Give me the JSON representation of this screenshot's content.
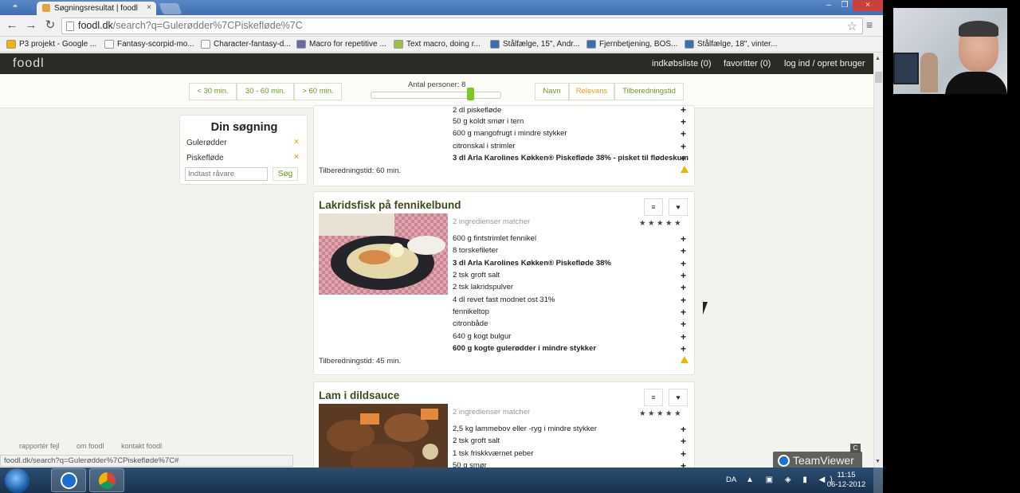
{
  "browser": {
    "tab_title": "Søgningsresultat | foodl",
    "tab_close": "×",
    "url_host": "foodl.dk",
    "url_path": "/search?q=Gulerødder%7CPiskefløde%7C",
    "nav_back": "←",
    "nav_forward": "→",
    "nav_reload": "↻",
    "star": "☆",
    "menu": "≡",
    "bookmarks": [
      {
        "label": "P3 projekt - Google ...",
        "color": "#f4b400"
      },
      {
        "label": "Fantasy-scorpid-mo...",
        "color": "#ffffff"
      },
      {
        "label": "Character-fantasy-d...",
        "color": "#ffffff"
      },
      {
        "label": "Macro for repetitive ...",
        "color": "#6a6aa0"
      },
      {
        "label": "Text macro, doing r...",
        "color": "#a0c040"
      },
      {
        "label": "Stålfælge, 15\", Andr...",
        "color": "#3a6fb0"
      },
      {
        "label": "Fjernbetjening, BOS...",
        "color": "#3a6fb0"
      },
      {
        "label": "Stålfælge, 18\", vinter...",
        "color": "#3a6fb0"
      }
    ],
    "status_url": "foodl.dk/search?q=Gulerødder%7CPiskefløde%7C#"
  },
  "site": {
    "logo": "foodl",
    "header_links": {
      "shopping_list": "indkøbsliste (0)",
      "favorites": "favoritter (0)",
      "login": "log ind / opret bruger"
    },
    "time_filters": [
      "< 30 min.",
      "30 - 60 min.",
      "> 60 min."
    ],
    "persons_label": "Antal personer: 8",
    "persons_value": 8,
    "sort_options": [
      "Navn",
      "Relevans",
      "Tilberedningstid"
    ],
    "active_sort": "Relevans",
    "search_panel": {
      "title": "Din søgning",
      "terms": [
        "Gulerødder",
        "Piskefløde"
      ],
      "remove_glyph": "×",
      "input_placeholder": "Indtast råvare",
      "button": "Søg"
    },
    "footer_links": [
      "rapportér fejl",
      "om foodl",
      "kontakt foodl"
    ]
  },
  "recipes": [
    {
      "title": "",
      "ingredients": [
        {
          "text": "2 dl piskefløde",
          "bold": false
        },
        {
          "text": "50 g koldt smør i tern",
          "bold": false
        },
        {
          "text": "600 g mangofrugt i mindre stykker",
          "bold": false
        },
        {
          "text": "citronskal i strimler",
          "bold": false
        },
        {
          "text": "3 dl Arla Karolines Køkken® Piskefløde 38% - pisket til flødeskum",
          "bold": true
        }
      ],
      "prep_time": "Tilberedningstid: 60 min."
    },
    {
      "title": "Lakridsfisk på fennikelbund",
      "match": "2 ingredienser matcher",
      "stars": "★★★★★",
      "ingredients": [
        {
          "text": "600 g fintstrimlet fennikel",
          "bold": false
        },
        {
          "text": "8 torskefileter",
          "bold": false
        },
        {
          "text": "3 dl Arla Karolines Køkken® Piskefløde 38%",
          "bold": true
        },
        {
          "text": "2 tsk groft salt",
          "bold": false
        },
        {
          "text": "2 tsk lakridspulver",
          "bold": false
        },
        {
          "text": "4 dl revet fast modnet ost 31%",
          "bold": false
        },
        {
          "text": "fennikeltop",
          "bold": false
        },
        {
          "text": "citronbåde",
          "bold": false
        },
        {
          "text": "640 g kogt bulgur",
          "bold": false
        },
        {
          "text": "600 g kogte gulerødder i mindre stykker",
          "bold": true
        }
      ],
      "prep_time": "Tilberedningstid: 45 min."
    },
    {
      "title": "Lam i dildsauce",
      "match": "2 ingredienser matcher",
      "stars": "★★★★★",
      "ingredients": [
        {
          "text": "2,5 kg lammebov eller -ryg i mindre stykker",
          "bold": false
        },
        {
          "text": "2 tsk groft salt",
          "bold": false
        },
        {
          "text": "1 tsk friskkværnet peber",
          "bold": false
        },
        {
          "text": "50 g smør",
          "bold": false
        }
      ]
    }
  ],
  "plus_glyph": "+",
  "list_glyph": "≡",
  "heart_glyph": "♥",
  "teamviewer": {
    "label": "TeamViewer",
    "close": "C"
  },
  "taskbar": {
    "lang": "DA",
    "tray": "▲ ▣ ◈ ▮ ◀)",
    "time": "11:15",
    "date": "06-12-2012"
  },
  "colors": {
    "accent_green": "#6a9a1a",
    "accent_orange": "#e6a117",
    "header_dark": "#2b2b26"
  }
}
